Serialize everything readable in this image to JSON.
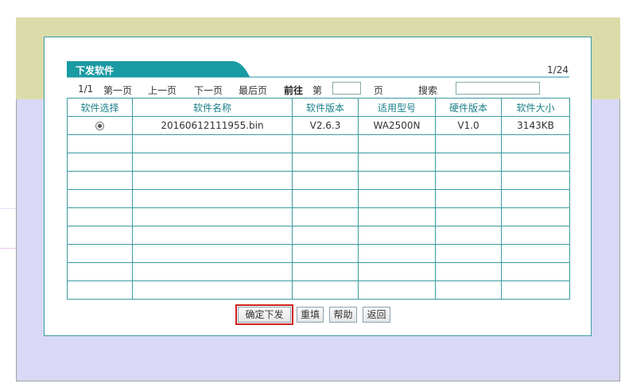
{
  "panel": {
    "title": "下发软件",
    "page_count": "1/24"
  },
  "pager": {
    "current": "1/1",
    "first": "第一页",
    "prev": "上一页",
    "next": "下一页",
    "last": "最后页",
    "goto": "前往",
    "di": "第",
    "page_input_value": "",
    "ye": "页",
    "search": "搜索",
    "search_value": ""
  },
  "table": {
    "headers": [
      "软件选择",
      "软件名称",
      "软件版本",
      "适用型号",
      "硬件版本",
      "软件大小"
    ],
    "row": {
      "selected": true,
      "name": "20160612111955.bin",
      "version": "V2.6.3",
      "model": "WA2500N",
      "hw": "V1.0",
      "size": "3143KB"
    },
    "empty_rows": 9
  },
  "buttons": {
    "confirm": "确定下发",
    "reset": "重填",
    "help": "帮助",
    "back": "返回"
  },
  "colors": {
    "accent": "#1a9aa3",
    "highlight": "#d02020"
  }
}
